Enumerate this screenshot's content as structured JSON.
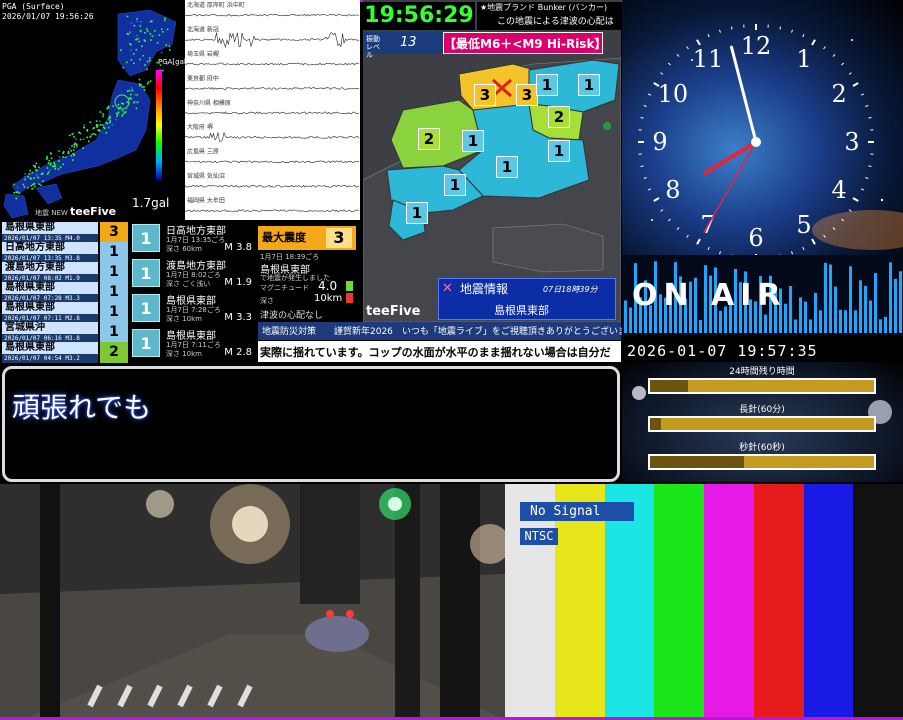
{
  "map_panel": {
    "pga_label": "PGA (Surface)",
    "timestamp": "2026/01/07 19:56:26",
    "scale_title": "PGA[gal]",
    "gal_value": "1.7gal",
    "brand": "teeFive",
    "new_label": "地震 NEW"
  },
  "seismograph": {
    "stations": [
      "北海道 厚岸町 浜中町",
      "北海道 新冠",
      "埼玉県 岩槻",
      "東京都 府中",
      "神奈川県 相模原",
      "大阪府 堺",
      "広島県 三原",
      "宮城県 気仙沼",
      "福岡県 大牟田"
    ]
  },
  "eq_list": [
    {
      "region": "島根県東部",
      "time": "2026/01/07 13:35",
      "mag": "M4.0",
      "intensity": "3",
      "color": "#f3a818"
    },
    {
      "region": "日高地方東部",
      "time": "2026/01/07 13:35",
      "mag": "M3.8",
      "intensity": "1",
      "color": "#8cc6e8"
    },
    {
      "region": "渡島地方東部",
      "time": "2026/01/07 08:02",
      "mag": "M1.9",
      "intensity": "1",
      "color": "#8cc6e8"
    },
    {
      "region": "島根県東部",
      "time": "2026/01/07 07:28",
      "mag": "M3.3",
      "intensity": "1",
      "color": "#8cc6e8"
    },
    {
      "region": "島根県東部",
      "time": "2026/01/07 07:11",
      "mag": "M2.8",
      "intensity": "1",
      "color": "#8cc6e8"
    },
    {
      "region": "宮城県沖",
      "time": "2026/01/07 06:16",
      "mag": "M3.8",
      "intensity": "1",
      "color": "#8cc6e8"
    },
    {
      "region": "島根県東部",
      "time": "2026/01/07 04:54",
      "mag": "M3.2",
      "intensity": "2",
      "color": "#7ec832"
    }
  ],
  "mid_list": [
    {
      "intensity": "1",
      "region": "日高地方東部",
      "time": "1月7日 13:35ごろ",
      "depth": "深さ 60km",
      "mag": "M 3.8"
    },
    {
      "intensity": "1",
      "region": "渡島地方東部",
      "time": "1月7日 8:02ごろ",
      "depth": "深さ ごく浅い",
      "mag": "M 1.9"
    },
    {
      "intensity": "1",
      "region": "島根県東部",
      "time": "1月7日 7:28ごろ",
      "depth": "深さ 10km",
      "mag": "M 3.3"
    },
    {
      "intensity": "1",
      "region": "島根県東部",
      "time": "1月7日 7:11ごろ",
      "depth": "深さ 10km",
      "mag": "M 2.8"
    }
  ],
  "max_panel": {
    "label": "最大震度",
    "value": "3",
    "time": "1月7日 18:39ごろ",
    "region": "島根県東部",
    "tsunami_note": "で地震が発生しました",
    "magnitude_label": "マグニチュード",
    "magnitude": "4.0",
    "depth_label": "深さ",
    "depth": "10km",
    "footer": "津波の心配なし"
  },
  "center_map": {
    "digital_clock": "19:56:29",
    "bunker_title": "★地震ブランド Bunker (バンカー)",
    "bunker_msg": "この地震による津波の心配はなし",
    "level_label": "振動レベル",
    "level_value": "13",
    "risk_text": "【最低M6＋<M9 Hi-Risk】",
    "brand": "teeFive",
    "jishin_title": "地震情報",
    "jishin_time": "07日18時39分",
    "jishin_place": "島根県東部",
    "intensities": [
      "3",
      "3",
      "1",
      "1",
      "2",
      "2",
      "1",
      "1",
      "1",
      "1",
      "1",
      "1"
    ]
  },
  "ticker": {
    "tag": "地震防災対策",
    "text1": "謹賀新年2026　いつも「地震ライブ」をご視聴頂きありがとうございます!",
    "text2": "実際に揺れています。コップの水面が水平のまま揺れない場合は自分だ"
  },
  "caption": {
    "text": "頑張れでも"
  },
  "clock": {
    "numerals": [
      "12",
      "1",
      "2",
      "3",
      "4",
      "5",
      "6",
      "7",
      "8",
      "9",
      "10",
      "11"
    ],
    "hour": 19,
    "minute": 57,
    "second": 35
  },
  "onair": {
    "text": "ON AIR",
    "datetime": "2026-01-07 19:57:35"
  },
  "timers": [
    {
      "label": "24時間残り時間",
      "fill": 0.17
    },
    {
      "label": "長針(60分)",
      "fill": 0.05
    },
    {
      "label": "秒針(60秒)",
      "fill": 0.42
    }
  ],
  "test_card": {
    "no_signal": "No Signal",
    "ntsc": "NTSC",
    "colors": [
      "#e6e6e6",
      "#e6e61a",
      "#1ae6e6",
      "#1ae61a",
      "#e61ae6",
      "#e61a1a",
      "#1a1ae6",
      "#111111"
    ]
  }
}
